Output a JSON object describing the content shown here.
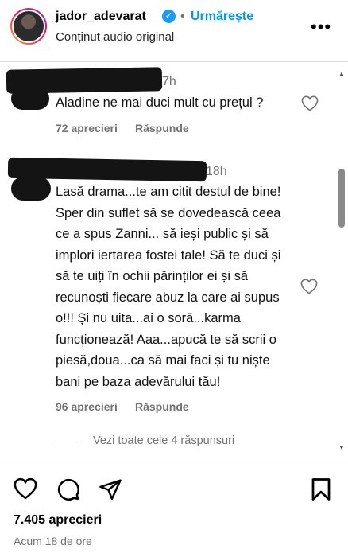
{
  "post_header": {
    "username": "jador_adevarat",
    "follow_label": "Urmărește",
    "subtitle": "Conținut audio original"
  },
  "comments": [
    {
      "time": "7h",
      "text": "Aladine ne mai duci mult cu prețul ?",
      "likes": "72 aprecieri",
      "reply_label": "Răspunde"
    },
    {
      "time": "18h",
      "text": "Lasă drama...te am citit destul de bine! Sper din suflet să se dovedească ceea ce a spus Zanni... să ieși public și să implori iertarea fostei tale! Să te duci și să te uiți în ochii părinților ei și să recunoști fiecare abuz la care ai supus o!!! Și nu uita...ai o soră...karma funcționează! Aaa...apucă te să scrii o piesă,doua...ca să mai faci și tu niște bani pe baza adevărului tău!",
      "likes": "96 aprecieri",
      "reply_label": "Răspunde",
      "view_replies": "Vezi toate cele 4 răspunsuri"
    }
  ],
  "footer": {
    "likes": "7.405 aprecieri",
    "posted": "Acum 18 de ore"
  },
  "icons": {
    "avatar": "profile-avatar",
    "verified": "verified-badge",
    "more": "more-options-icon",
    "like": "heart-icon",
    "comment": "comment-icon",
    "share": "share-icon",
    "save": "bookmark-icon"
  },
  "colors": {
    "follow": "#0095f6",
    "verified": "#1d9bf0",
    "muted": "#737373"
  }
}
